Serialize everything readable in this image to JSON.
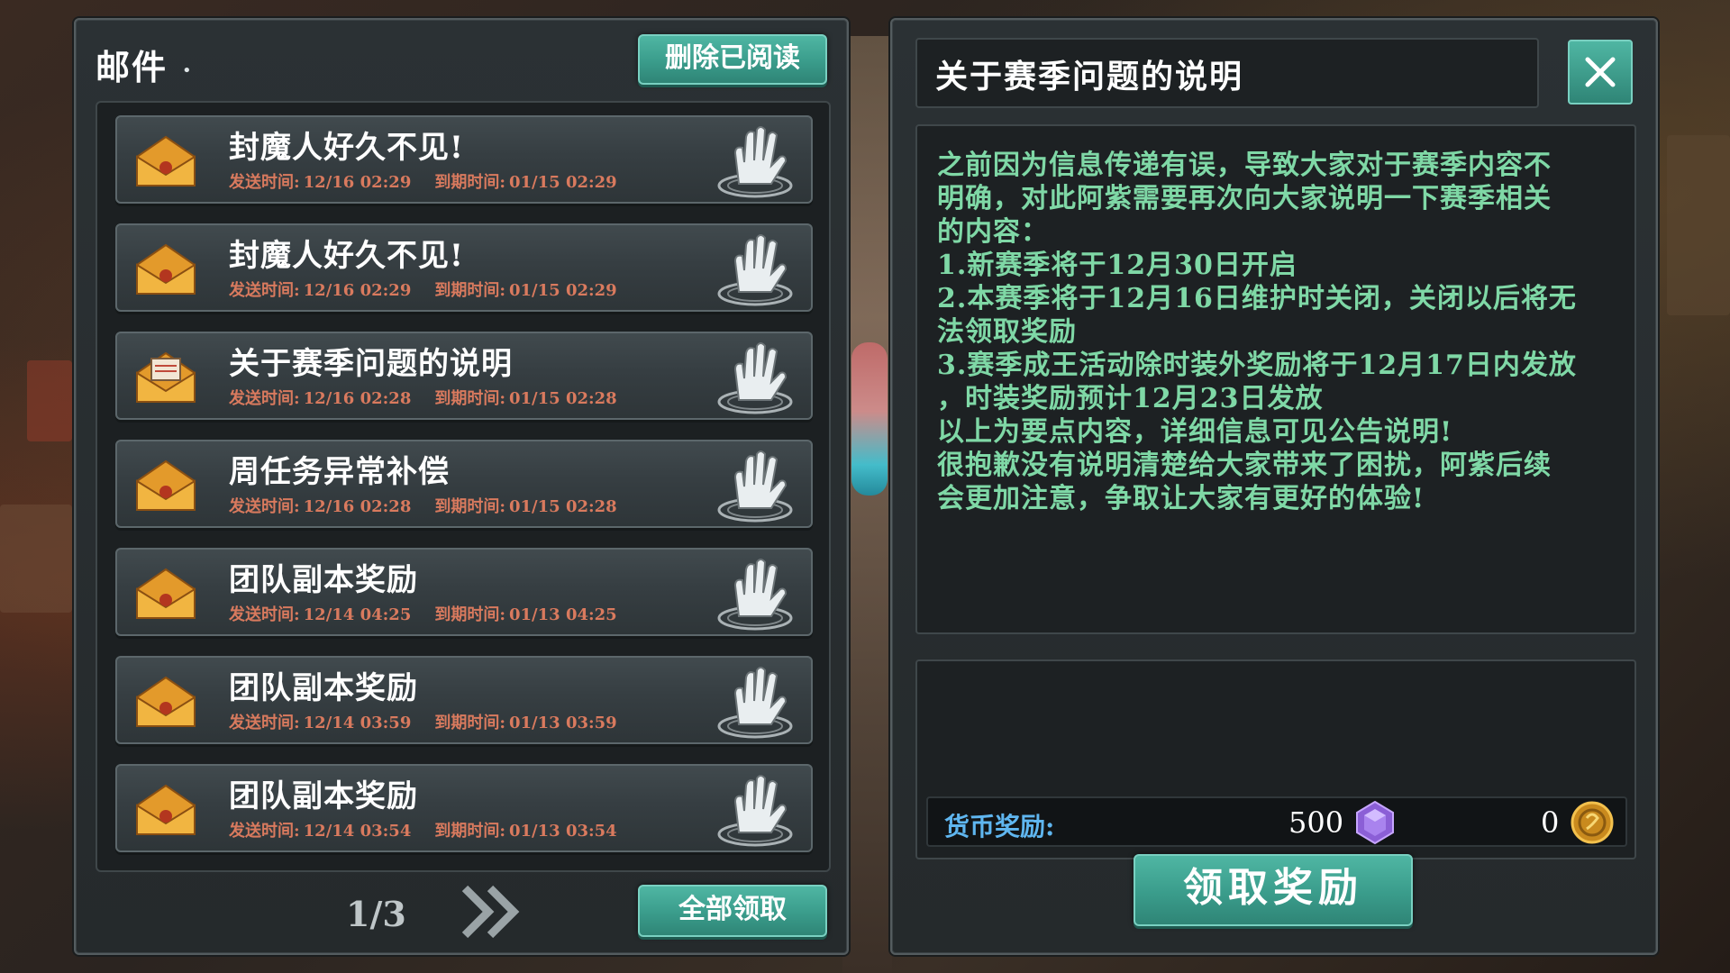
{
  "mail_panel": {
    "title": "邮件",
    "title_dot": "•",
    "delete_read_label": "删除已阅读",
    "claim_all_label": "全部领取",
    "page": "1/3",
    "items": [
      {
        "subject": "封魔人好久不见!",
        "sent_label": "发送时间:",
        "sent": "12/16 02:29",
        "expire_label": "到期时间:",
        "expire": "01/15 02:29",
        "icon": "closed-envelope-icon"
      },
      {
        "subject": "封魔人好久不见!",
        "sent_label": "发送时间:",
        "sent": "12/16 02:29",
        "expire_label": "到期时间:",
        "expire": "01/15 02:29",
        "icon": "closed-envelope-icon"
      },
      {
        "subject": "关于赛季问题的说明",
        "sent_label": "发送时间:",
        "sent": "12/16 02:28",
        "expire_label": "到期时间:",
        "expire": "01/15 02:28",
        "icon": "opened-envelope-icon"
      },
      {
        "subject": "周任务异常补偿",
        "sent_label": "发送时间:",
        "sent": "12/16 02:28",
        "expire_label": "到期时间:",
        "expire": "01/15 02:28",
        "icon": "closed-envelope-icon"
      },
      {
        "subject": "团队副本奖励",
        "sent_label": "发送时间:",
        "sent": "12/14 04:25",
        "expire_label": "到期时间:",
        "expire": "01/13 04:25",
        "icon": "closed-envelope-icon"
      },
      {
        "subject": "团队副本奖励",
        "sent_label": "发送时间:",
        "sent": "12/14 03:59",
        "expire_label": "到期时间:",
        "expire": "01/13 03:59",
        "icon": "closed-envelope-icon"
      },
      {
        "subject": "团队副本奖励",
        "sent_label": "发送时间:",
        "sent": "12/14 03:54",
        "expire_label": "到期时间:",
        "expire": "01/13 03:54",
        "icon": "closed-envelope-icon"
      }
    ]
  },
  "detail": {
    "title": "关于赛季问题的说明",
    "body_lines": [
      "之前因为信息传递有误，导致大家对于赛季内容不",
      "明确，对此阿紫需要再次向大家说明一下赛季相关",
      "的内容：",
      "1.新赛季将于12月30日开启",
      "2.本赛季将于12月16日维护时关闭，关闭以后将无",
      "法领取奖励",
      "3.赛季成王活动除时装外奖励将于12月17日内发放",
      "，时装奖励预计12月23日发放",
      "以上为要点内容，详细信息可见公告说明!",
      "很抱歉没有说明清楚给大家带来了困扰，阿紫后续",
      "会更加注意，争取让大家有更好的体验!"
    ],
    "currency_label": "货币奖励:",
    "gem_amount": "500",
    "gold_amount": "0",
    "claim_label": "领取奖励"
  },
  "colors": {
    "accent_teal": "#3a9c8b",
    "body_text_green": "#7fd8a6",
    "meta_text_orange": "#d97a5e",
    "currency_label_blue": "#5fb6f0"
  }
}
